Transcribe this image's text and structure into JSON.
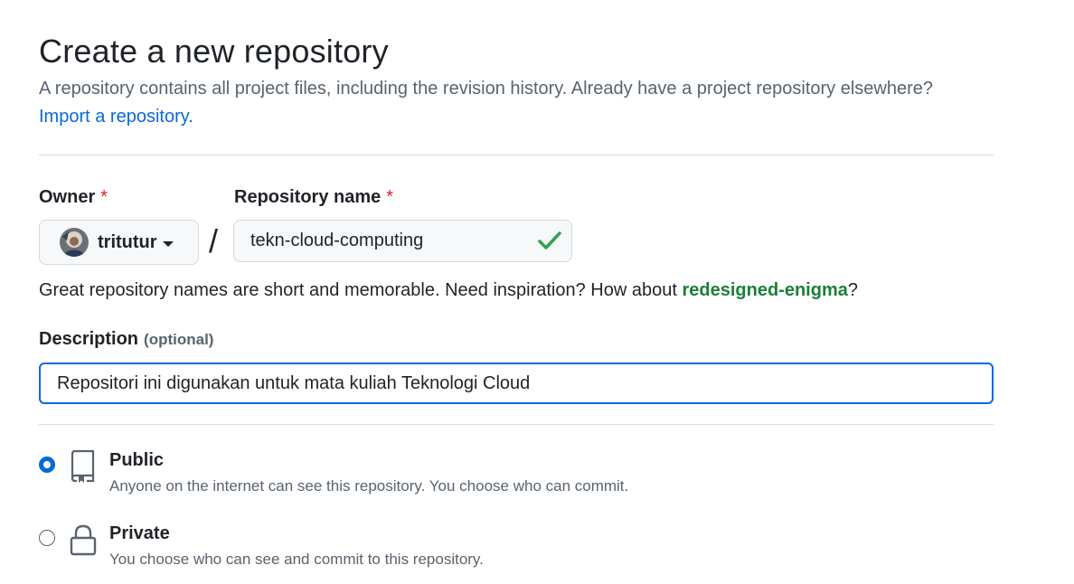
{
  "header": {
    "title": "Create a new repository",
    "subtitle": "A repository contains all project files, including the revision history. Already have a project repository elsewhere?",
    "import_link": "Import a repository."
  },
  "owner": {
    "label": "Owner",
    "required_mark": "*",
    "value": "tritutur"
  },
  "separator": "/",
  "repo_name": {
    "label": "Repository name",
    "required_mark": "*",
    "value": "tekn-cloud-computing",
    "valid": true
  },
  "hint": {
    "prefix": "Great repository names are short and memorable. Need inspiration? How about ",
    "suggestion": "redesigned-enigma",
    "suffix": "?"
  },
  "description": {
    "label": "Description",
    "optional_label": "(optional)",
    "value": "Repositori ini digunakan untuk mata kuliah Teknologi Cloud"
  },
  "visibility": {
    "selected": "public",
    "options": [
      {
        "id": "public",
        "title": "Public",
        "description": "Anyone on the internet can see this repository. You choose who can commit."
      },
      {
        "id": "private",
        "title": "Private",
        "description": "You choose who can see and commit to this repository."
      }
    ]
  },
  "colors": {
    "accent": "#0969da",
    "success": "#1a7f37",
    "check": "#2da44e",
    "required": "#d1242f"
  },
  "icons": {
    "public": "repo-icon",
    "private": "lock-icon",
    "valid": "check-icon"
  }
}
